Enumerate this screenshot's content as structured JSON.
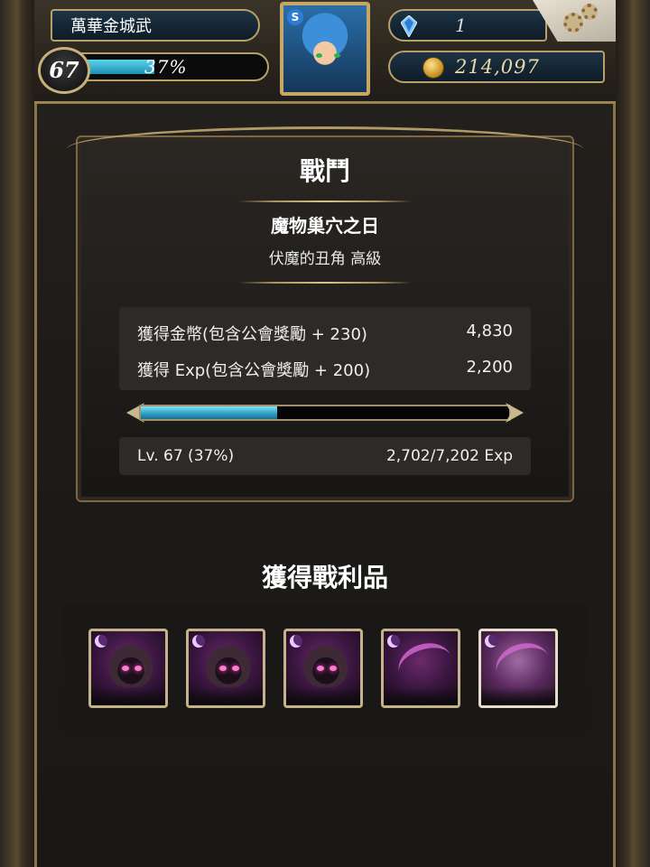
{
  "header": {
    "player_name": "萬華金城武",
    "level": "67",
    "exp_percent_label": "37%",
    "exp_fraction": 0.37,
    "gems": "1",
    "gold": "214,097"
  },
  "battle": {
    "title": "戰鬥",
    "stage_name": "魔物巢穴之日",
    "stage_subtitle": "伏魔的丑角 高級",
    "rewards": [
      {
        "label": "獲得金幣(包含公會獎勵 + 230)",
        "value": "4,830"
      },
      {
        "label": "獲得 Exp(包含公會獎勵 + 200)",
        "value": "2,200"
      }
    ],
    "progress_fraction": 0.37,
    "level_text": "Lv. 67 (37%)",
    "exp_text": "2,702/7,202 Exp"
  },
  "loot": {
    "title": "獲得戰利品",
    "items": [
      {
        "icon": "hooded-monster-icon"
      },
      {
        "icon": "hooded-monster-icon"
      },
      {
        "icon": "hooded-monster-icon"
      },
      {
        "icon": "jester-monster-icon"
      },
      {
        "icon": "jester-monster-icon"
      }
    ]
  },
  "colors": {
    "accent_gold": "#b8a06a",
    "exp_blue": "#2a9ec0",
    "background": "#1d1b18"
  }
}
